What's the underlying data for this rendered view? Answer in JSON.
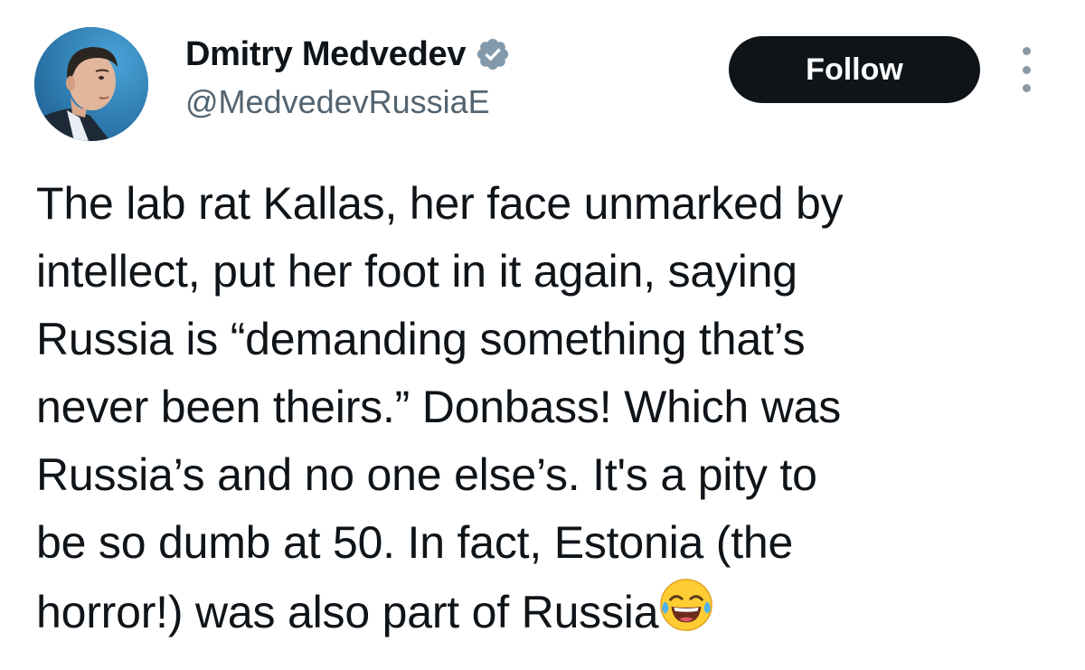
{
  "author": {
    "display_name": "Dmitry Medvedev",
    "handle": "@MedvedevRussiaE",
    "verified": true,
    "verified_icon": "verified-badge-icon"
  },
  "actions": {
    "follow_label": "Follow",
    "more_icon": "more-options-icon"
  },
  "tweet": {
    "lines": [
      "The lab rat Kallas, her face unmarked by",
      "intellect, put her foot in it again, saying",
      "Russia is “demanding something that’s",
      "never been theirs.” Donbass! Which was",
      "Russia’s and no one else’s. It's a pity to",
      "be so dumb at 50. In fact, Estonia (the",
      "horror!) was also part of Russia"
    ],
    "trailing_emoji": "face-with-tears-of-joy-emoji"
  },
  "colors": {
    "text": "#0f1419",
    "secondary_text": "#536471",
    "follow_bg": "#0f1419",
    "follow_text": "#ffffff",
    "verified": "#829aab",
    "avatar_bg": "#2a7fb8"
  }
}
